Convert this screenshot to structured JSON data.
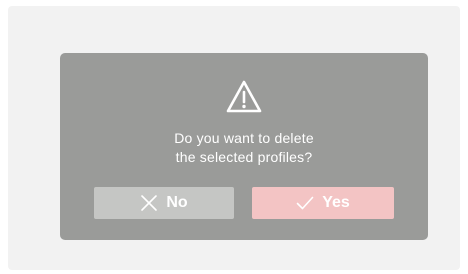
{
  "dialog": {
    "icon": "warning-triangle-icon",
    "message_line1": "Do you want to delete",
    "message_line2": "the selected profiles?",
    "no_button": {
      "icon": "close-icon",
      "label": "No"
    },
    "yes_button": {
      "icon": "check-icon",
      "label": "Yes"
    }
  },
  "colors": {
    "screen_background": "#f2f2f2",
    "dialog_background": "#9a9b99",
    "no_button_background": "#c5c6c4",
    "yes_button_background": "#f3c4c4",
    "text": "#ffffff"
  }
}
